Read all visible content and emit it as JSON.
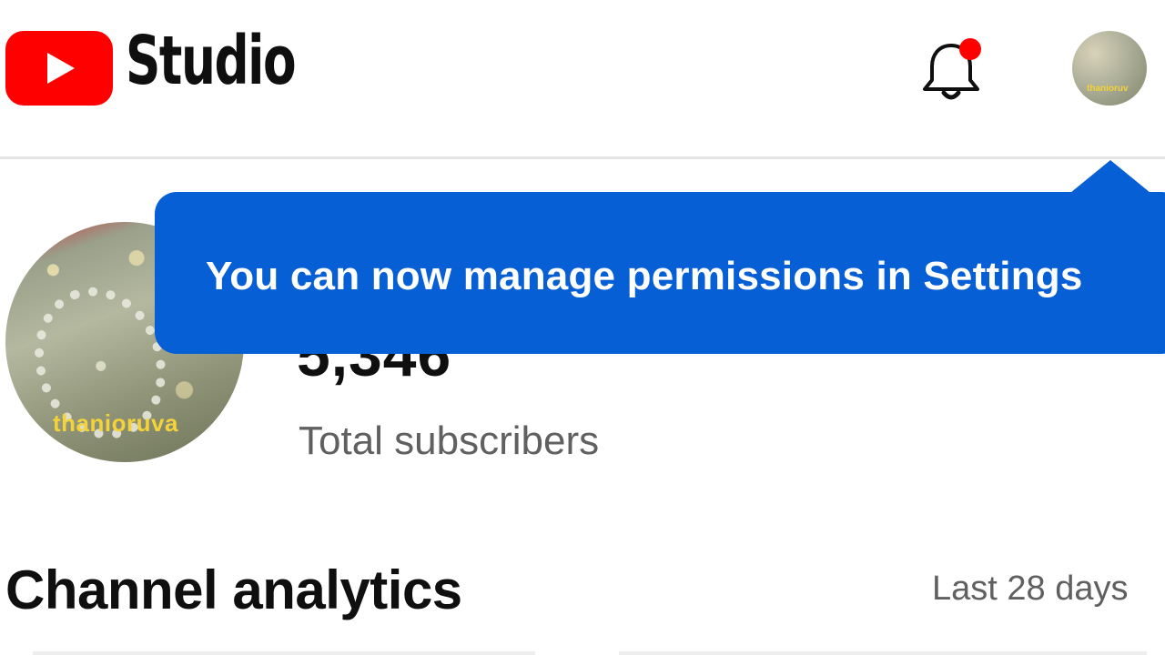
{
  "header": {
    "app_name": "Studio",
    "notification_dot_color": "#ff0000",
    "avatar_text": "thanioruv"
  },
  "channel": {
    "avatar_text": "thanioruva",
    "subscriber_count": "5,346",
    "subscriber_label": "Total subscribers"
  },
  "tooltip": {
    "message": "You can now manage permissions in Settings",
    "background_color": "#065fd4"
  },
  "analytics": {
    "title": "Channel analytics",
    "range": "Last 28 days"
  },
  "colors": {
    "brand_red": "#ff0000",
    "accent_blue": "#065fd4"
  }
}
